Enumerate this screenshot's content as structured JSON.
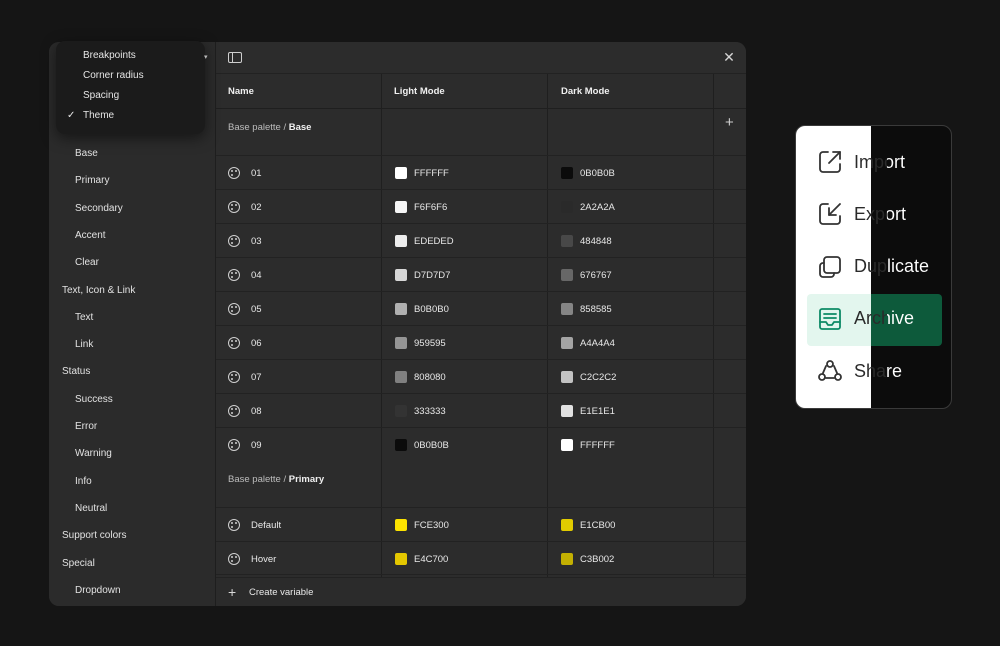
{
  "dropdown": {
    "items": [
      {
        "label": "Breakpoints",
        "checked": false
      },
      {
        "label": "Corner radius",
        "checked": false
      },
      {
        "label": "Spacing",
        "checked": false
      },
      {
        "label": "Theme",
        "checked": true
      }
    ],
    "check_glyph": "✓"
  },
  "sidebar": {
    "items": [
      {
        "label": "Base",
        "level": "sub"
      },
      {
        "label": "Primary",
        "level": "sub"
      },
      {
        "label": "Secondary",
        "level": "sub"
      },
      {
        "label": "Accent",
        "level": "sub"
      },
      {
        "label": "Clear",
        "level": "sub"
      },
      {
        "label": "Text, Icon & Link",
        "level": "group"
      },
      {
        "label": "Text",
        "level": "sub"
      },
      {
        "label": "Link",
        "level": "sub"
      },
      {
        "label": "Status",
        "level": "group"
      },
      {
        "label": "Success",
        "level": "sub"
      },
      {
        "label": "Error",
        "level": "sub"
      },
      {
        "label": "Warning",
        "level": "sub"
      },
      {
        "label": "Info",
        "level": "sub"
      },
      {
        "label": "Neutral",
        "level": "sub"
      },
      {
        "label": "Support colors",
        "level": "group"
      },
      {
        "label": "Special",
        "level": "group"
      },
      {
        "label": "Dropdown",
        "level": "sub"
      }
    ]
  },
  "table": {
    "columns": [
      "Name",
      "Light Mode",
      "Dark Mode"
    ],
    "add_column_glyph": "+",
    "close_glyph": "✕",
    "sections": [
      {
        "path": "Base palette / ",
        "group": "Base",
        "rows": [
          {
            "name": "01",
            "light": "FFFFFF",
            "dark": "0B0B0B"
          },
          {
            "name": "02",
            "light": "F6F6F6",
            "dark": "2A2A2A"
          },
          {
            "name": "03",
            "light": "EDEDED",
            "dark": "484848"
          },
          {
            "name": "04",
            "light": "D7D7D7",
            "dark": "676767"
          },
          {
            "name": "05",
            "light": "B0B0B0",
            "dark": "858585"
          },
          {
            "name": "06",
            "light": "959595",
            "dark": "A4A4A4"
          },
          {
            "name": "07",
            "light": "808080",
            "dark": "C2C2C2"
          },
          {
            "name": "08",
            "light": "333333",
            "dark": "E1E1E1"
          },
          {
            "name": "09",
            "light": "0B0B0B",
            "dark": "FFFFFF"
          }
        ]
      },
      {
        "path": "Base palette / ",
        "group": "Primary",
        "rows": [
          {
            "name": "Default",
            "light": "FCE300",
            "dark": "E1CB00"
          },
          {
            "name": "Hover",
            "light": "E4C700",
            "dark": "C3B002"
          }
        ]
      }
    ],
    "footer": {
      "plus_glyph": "+",
      "label": "Create variable"
    }
  },
  "context_menu": {
    "items": [
      {
        "label": "Import",
        "icon": "import-icon",
        "active": false
      },
      {
        "label": "Export",
        "icon": "export-icon",
        "active": false
      },
      {
        "label": "Duplicate",
        "icon": "duplicate-icon",
        "active": false
      },
      {
        "label": "Archive",
        "icon": "archive-icon",
        "active": true
      },
      {
        "label": "Share",
        "icon": "share-icon",
        "active": false
      }
    ],
    "colors": {
      "light_bg": "#FFFFFF",
      "dark_bg": "#0C0C0C",
      "active_light": "#E3F6EE",
      "active_dark": "#0D5A3B",
      "active_icon": "#0D8A66"
    }
  }
}
